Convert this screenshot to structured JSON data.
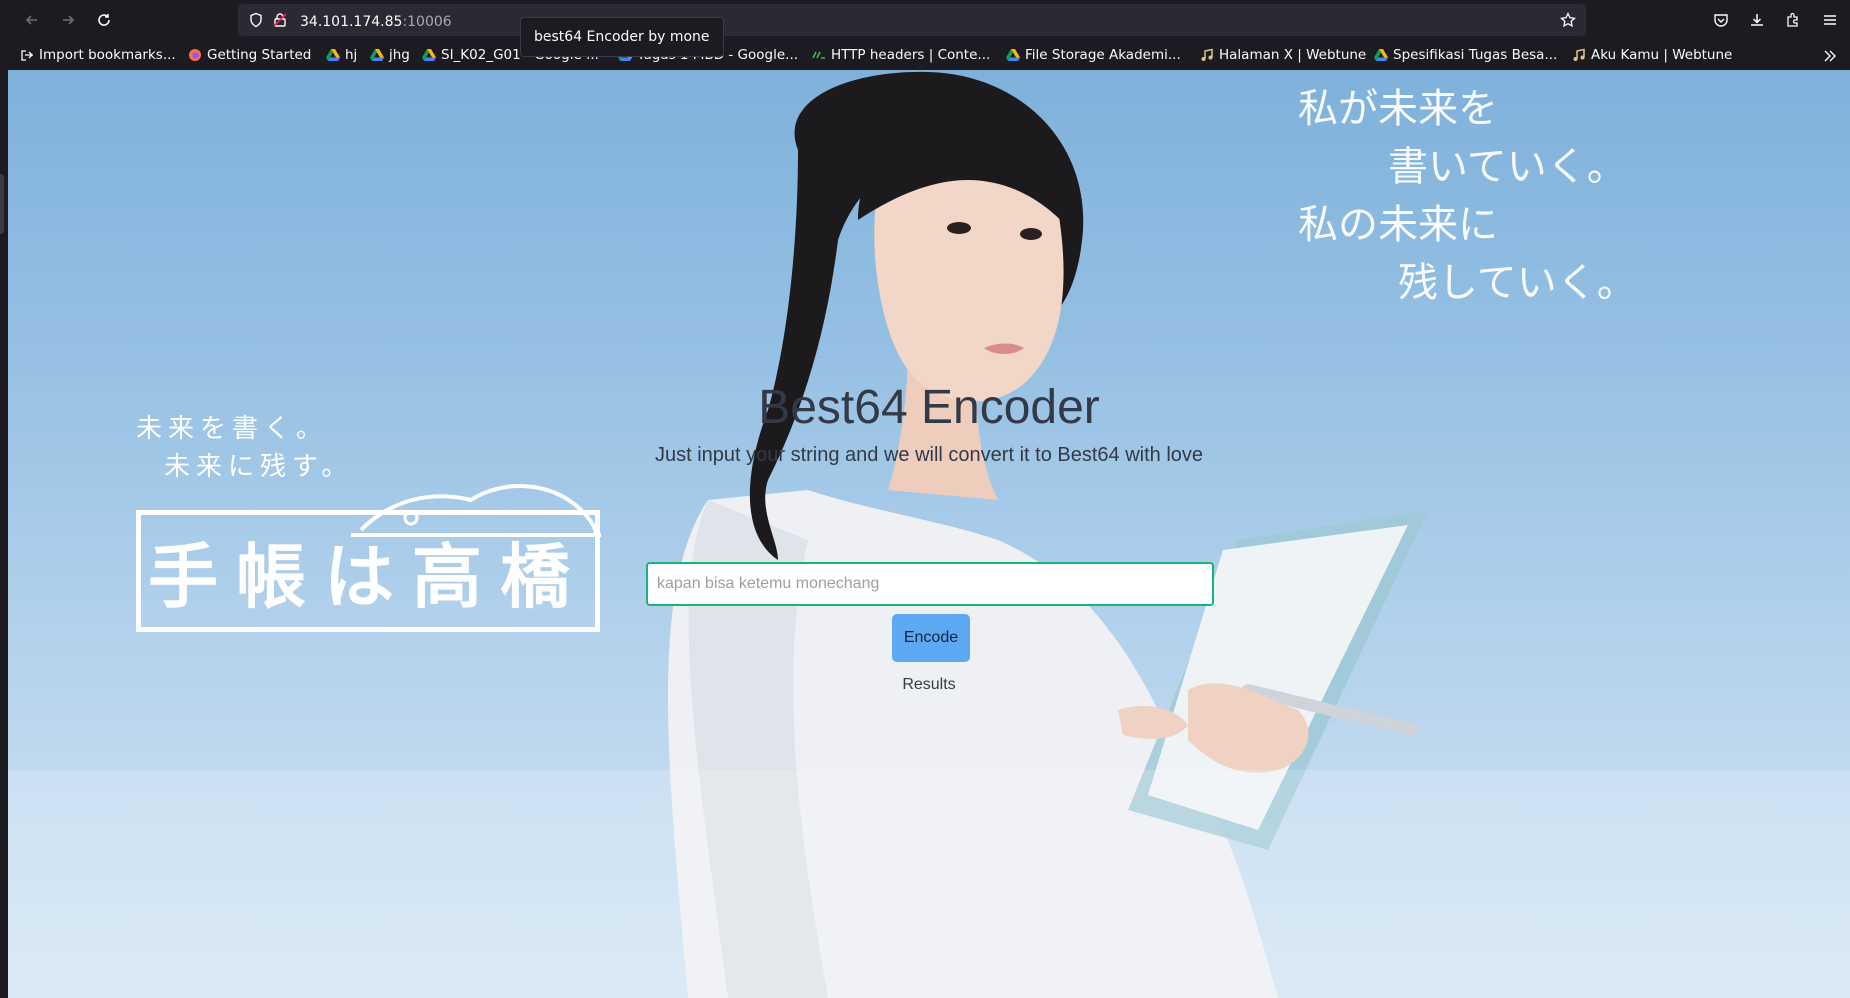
{
  "browser": {
    "url_host": "34.101.174.85",
    "url_port": ":10006",
    "tooltip": "best64 Encoder by mone",
    "bookmarks": [
      {
        "label": "Import bookmarks...",
        "icon": "import-icon"
      },
      {
        "label": "Getting Started",
        "icon": "firefox-icon"
      },
      {
        "label": "hj",
        "icon": "google-drive-icon"
      },
      {
        "label": "jhg",
        "icon": "google-drive-icon"
      },
      {
        "label": "SI_K02_G01 - Google ...",
        "icon": "google-drive-icon"
      },
      {
        "label": "Tugas 1 MBD - Google...",
        "icon": "google-drive-icon"
      },
      {
        "label": "HTTP headers | Conte...",
        "icon": "mdn-icon"
      },
      {
        "label": "File Storage Akademi...",
        "icon": "google-drive-icon"
      },
      {
        "label": "Halaman X | Webtune",
        "icon": "music-note-icon"
      },
      {
        "label": "Spesifikasi Tugas Besa...",
        "icon": "google-drive-icon"
      },
      {
        "label": "Aku Kamu | Webtune",
        "icon": "music-note-icon"
      }
    ]
  },
  "hero": {
    "handwriting_lines": [
      "私が未来を",
      "書いていく。",
      "私の未来に",
      "残していく。"
    ],
    "logo_sub_lines": [
      "未来を書く。",
      "未来に残す。"
    ],
    "logo_text": "手帳は高橋"
  },
  "app": {
    "title": "Best64 Encoder",
    "subtitle": "Just input your string and we will convert it to Best64 with love",
    "input_value": "",
    "input_placeholder": "kapan bisa ketemu monechang",
    "encode_label": "Encode",
    "results_label": "Results"
  },
  "colors": {
    "accent_input_border": "#18b37e",
    "button_bg": "#5da8f2",
    "sky": "#95c0e3"
  }
}
